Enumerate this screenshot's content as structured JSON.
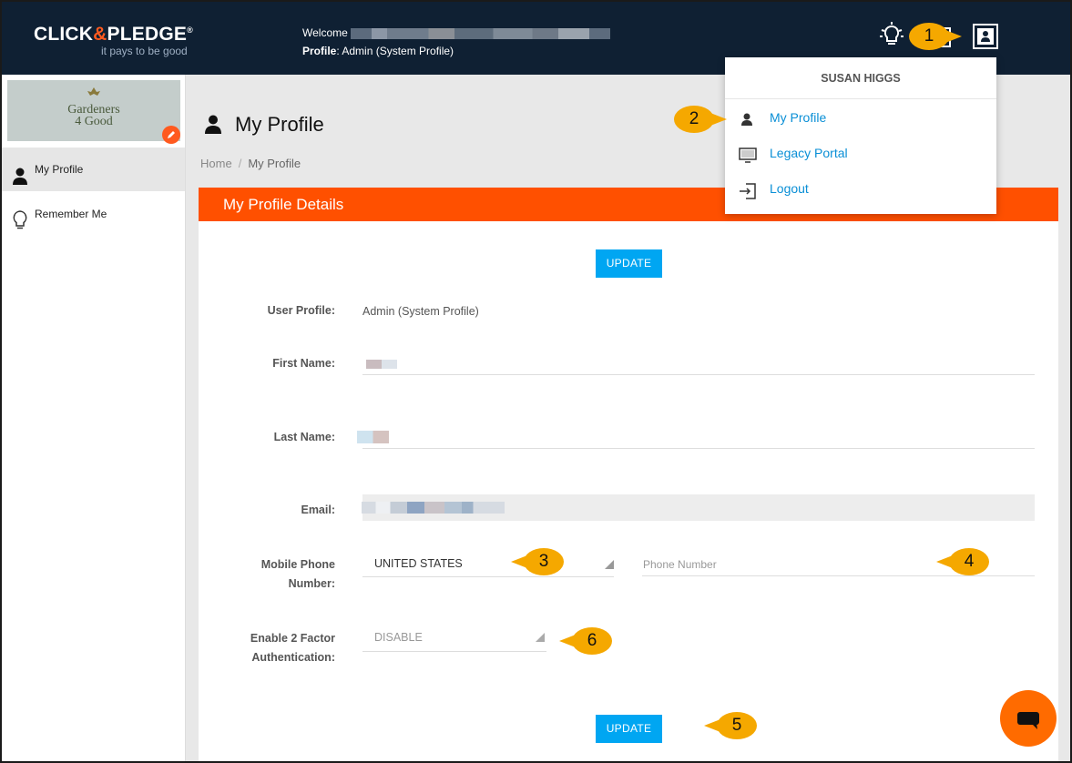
{
  "header": {
    "logo_main_left": "CLICK",
    "logo_amp": "&",
    "logo_main_right": "PLEDGE",
    "logo_reg": "®",
    "logo_tagline": "it pays to be good",
    "welcome_label": "Welcome",
    "profile_label": "Profile",
    "profile_value": ": Admin (System Profile)"
  },
  "user_menu": {
    "user_name": "SUSAN HIGGS",
    "items": [
      {
        "label": "My Profile",
        "icon": "person-icon"
      },
      {
        "label": "Legacy Portal",
        "icon": "monitor-icon"
      },
      {
        "label": "Logout",
        "icon": "logout-icon"
      }
    ]
  },
  "sidebar": {
    "org_logo_line1": "Gardeners",
    "org_logo_line2": "4 Good",
    "items": [
      {
        "label": "My Profile",
        "icon": "person-icon",
        "active": true
      },
      {
        "label": "Remember Me",
        "icon": "lightbulb-icon",
        "active": false
      }
    ]
  },
  "page": {
    "title": "My Profile",
    "breadcrumb": [
      "Home",
      "/",
      "My Profile"
    ]
  },
  "panel": {
    "title": "My Profile Details",
    "update_top": "UPDATE",
    "update_bottom": "UPDATE",
    "fields": {
      "user_profile_label": "User Profile:",
      "user_profile_value": "Admin (System Profile)",
      "first_name_label": "First Name:",
      "last_name_label": "Last Name:",
      "email_label": "Email:",
      "mobile_label_1": "Mobile Phone",
      "mobile_label_2": "Number:",
      "country_value": "UNITED STATES",
      "phone_placeholder": "Phone Number",
      "tfa_label_1": "Enable 2 Factor",
      "tfa_label_2": "Authentication:",
      "tfa_value": "DISABLE"
    }
  },
  "callouts": [
    "1",
    "2",
    "3",
    "4",
    "5",
    "6"
  ],
  "colors": {
    "header_bg": "#0f2033",
    "accent_orange": "#ff5000",
    "button_blue": "#00a6f2",
    "link_blue": "#0a8fd6",
    "callout_yellow": "#f5a800"
  }
}
